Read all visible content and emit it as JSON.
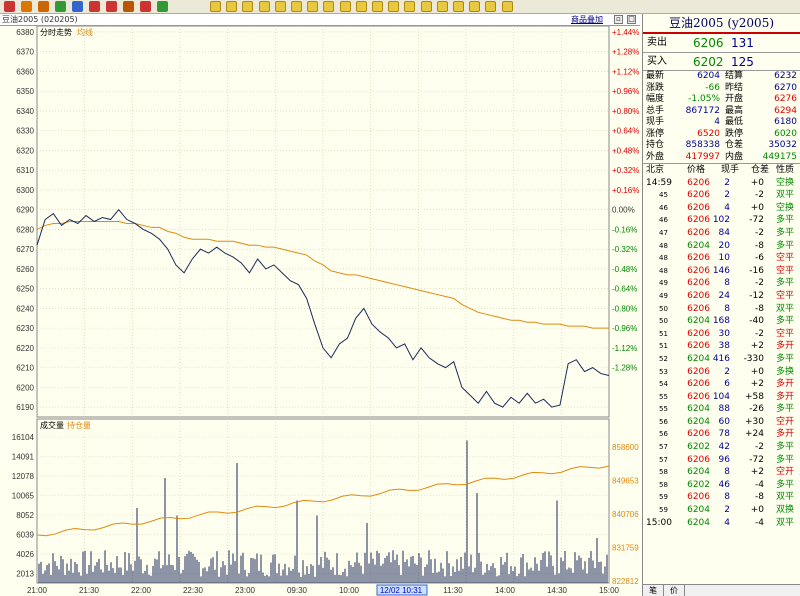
{
  "window": {
    "symbol_label": "豆油2005 (020205)"
  },
  "toolbar": {
    "overlay_button": "商品叠加"
  },
  "chart": {
    "price_panel_title": "分时走势",
    "avg_label": "均线",
    "volume_panel_title": "成交量",
    "oi_label": "持仓量",
    "price_ticks": [
      "6380",
      "6370",
      "6360",
      "6350",
      "6340",
      "6330",
      "6320",
      "6310",
      "6300",
      "6290",
      "6280",
      "6270",
      "6260",
      "6250",
      "6240",
      "6230",
      "6220",
      "6210",
      "6200",
      "6190"
    ],
    "pct_ticks": [
      "+1.44%",
      "+1.28%",
      "+1.12%",
      "+0.96%",
      "+0.80%",
      "+0.64%",
      "+0.48%",
      "+0.32%",
      "+0.16%",
      "0.00%",
      "-0.16%",
      "-0.32%",
      "-0.48%",
      "-0.64%",
      "-0.80%",
      "-0.96%",
      "-1.12%",
      "-1.28%"
    ],
    "vol_ticks": [
      "16104",
      "14091",
      "12078",
      "10065",
      "8052",
      "6039",
      "4026",
      "2013"
    ],
    "oi_ticks": [
      "858600",
      "849653",
      "840706",
      "831759",
      "822812"
    ],
    "time_labels": [
      "21:00",
      "21:30",
      "22:00",
      "22:30",
      "23:00",
      "09:30",
      "10:00",
      "12/02 10:31",
      "11:30",
      "14:00",
      "14:30",
      "15:00"
    ],
    "colors": {
      "price": "#1a2a5a",
      "avg": "#e08a10",
      "oi": "#e08a10",
      "vol": "#1a2a5a",
      "grid": "#cfcfa8",
      "bg": "#fffff0"
    }
  },
  "chart_data": {
    "type": "line",
    "title": "分时走势",
    "ylim": [
      6185,
      6383
    ],
    "series": [
      {
        "name": "price",
        "values": [
          6272,
          6285,
          6288,
          6282,
          6285,
          6283,
          6287,
          6284,
          6286,
          6285,
          6290,
          6285,
          6283,
          6280,
          6278,
          6275,
          6270,
          6262,
          6258,
          6265,
          6270,
          6268,
          6271,
          6268,
          6266,
          6263,
          6258,
          6265,
          6260,
          6262,
          6258,
          6254,
          6252,
          6245,
          6232,
          6220,
          6215,
          6222,
          6225,
          6235,
          6240,
          6232,
          6228,
          6225,
          6220,
          6222,
          6214,
          6220,
          6215,
          6212,
          6210,
          6213,
          6200,
          6196,
          6192,
          6198,
          6192,
          6190,
          6195,
          6192,
          6197,
          6192,
          6194,
          6190,
          6191,
          6212,
          6214,
          6208,
          6210,
          6207,
          6206
        ]
      },
      {
        "name": "avg",
        "values": [
          6280,
          6282,
          6283,
          6283,
          6284,
          6284,
          6284,
          6284,
          6284,
          6284,
          6284,
          6283,
          6283,
          6282,
          6281,
          6281,
          6279,
          6278,
          6276,
          6275,
          6275,
          6275,
          6274,
          6274,
          6274,
          6273,
          6272,
          6272,
          6271,
          6271,
          6270,
          6269,
          6268,
          6267,
          6264,
          6262,
          6259,
          6258,
          6257,
          6257,
          6256,
          6255,
          6254,
          6253,
          6252,
          6251,
          6250,
          6249,
          6248,
          6247,
          6246,
          6245,
          6242,
          6240,
          6238,
          6237,
          6236,
          6235,
          6234,
          6234,
          6233,
          6233,
          6232,
          6232,
          6232,
          6231,
          6231,
          6231,
          6230,
          6230,
          6230
        ]
      }
    ]
  },
  "quote": {
    "title": "豆油2005 (y2005)",
    "sell": {
      "label": "卖出",
      "price": "6206",
      "qty": "131"
    },
    "buy": {
      "label": "买入",
      "price": "6202",
      "qty": "125"
    },
    "rows": [
      [
        "最新",
        "6204",
        "结算",
        "6232"
      ],
      [
        "涨跌",
        "-66",
        "昨结",
        "6270"
      ],
      [
        "幅度",
        "-1.05%",
        "开盘",
        "6276"
      ],
      [
        "总手",
        "867172",
        "最高",
        "6294"
      ],
      [
        "现手",
        "4",
        "最低",
        "6180"
      ],
      [
        "涨停",
        "6520",
        "跌停",
        "6020"
      ],
      [
        "持仓",
        "858338",
        "仓差",
        "35032"
      ],
      [
        "外盘",
        "417997",
        "内盘",
        "449175"
      ]
    ],
    "tick_header": [
      "北京",
      "价格",
      "现手",
      "仓差",
      "性质"
    ],
    "ticks": [
      [
        "14:59",
        "6206",
        "2",
        "+0",
        "空换"
      ],
      [
        "45",
        "6206",
        "2",
        "-2",
        "双平"
      ],
      [
        "46",
        "6206",
        "4",
        "+0",
        "空换"
      ],
      [
        "46",
        "6206",
        "102",
        "-72",
        "多平"
      ],
      [
        "47",
        "6206",
        "84",
        "-2",
        "多平"
      ],
      [
        "48",
        "6204",
        "20",
        "-8",
        "多平"
      ],
      [
        "48",
        "6206",
        "10",
        "-6",
        "空平"
      ],
      [
        "48",
        "6206",
        "146",
        "-16",
        "空平"
      ],
      [
        "49",
        "6206",
        "8",
        "-2",
        "多平"
      ],
      [
        "49",
        "6206",
        "24",
        "-12",
        "空平"
      ],
      [
        "50",
        "6206",
        "8",
        "-8",
        "双平"
      ],
      [
        "50",
        "6204",
        "168",
        "-40",
        "多平"
      ],
      [
        "51",
        "6206",
        "30",
        "-2",
        "空平"
      ],
      [
        "51",
        "6206",
        "38",
        "+2",
        "多开"
      ],
      [
        "52",
        "6204",
        "416",
        "-330",
        "多平"
      ],
      [
        "53",
        "6206",
        "2",
        "+0",
        "多换"
      ],
      [
        "54",
        "6206",
        "6",
        "+2",
        "多开"
      ],
      [
        "55",
        "6206",
        "104",
        "+58",
        "多开"
      ],
      [
        "55",
        "6204",
        "88",
        "-26",
        "多平"
      ],
      [
        "56",
        "6204",
        "60",
        "+30",
        "空开"
      ],
      [
        "56",
        "6206",
        "78",
        "+24",
        "多开"
      ],
      [
        "57",
        "6202",
        "42",
        "-2",
        "多平"
      ],
      [
        "57",
        "6206",
        "96",
        "-72",
        "多平"
      ],
      [
        "58",
        "6204",
        "8",
        "+2",
        "空开"
      ],
      [
        "58",
        "6202",
        "46",
        "-4",
        "多平"
      ],
      [
        "59",
        "6206",
        "8",
        "-8",
        "双平"
      ],
      [
        "59",
        "6204",
        "2",
        "+0",
        "双换"
      ],
      [
        "15:00",
        "6204",
        "4",
        "-4",
        "双平"
      ]
    ],
    "tabs": [
      "笔",
      "价"
    ]
  }
}
